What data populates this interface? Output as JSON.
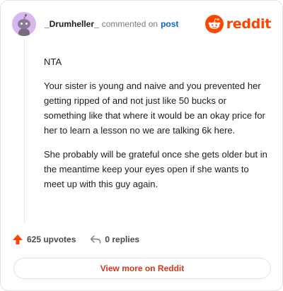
{
  "comment": {
    "username": "_Drumheller_",
    "action_text": "commented on",
    "post_link_label": "post",
    "paragraphs": [
      "NTA",
      "Your sister is young and naive and you prevented her getting ripped of and not just like 50 bucks or something like that where it would be an okay price for her to learn a lesson no we are talking 6k here.",
      "She probably will be grateful once she gets older but in the meantime keep your eyes open if she wants to meet up with this guy again."
    ]
  },
  "brand": {
    "name": "reddit",
    "icon": "reddit-logo-icon",
    "color": "#ff4500"
  },
  "actions": {
    "upvotes_label": "625 upvotes",
    "upvote_icon": "upvote-arrow-icon",
    "upvote_color": "#ff4500",
    "replies_label": "0 replies",
    "reply_icon": "reply-arrow-icon"
  },
  "footer": {
    "view_more_label": "View more on Reddit",
    "color": "#d4381c"
  }
}
